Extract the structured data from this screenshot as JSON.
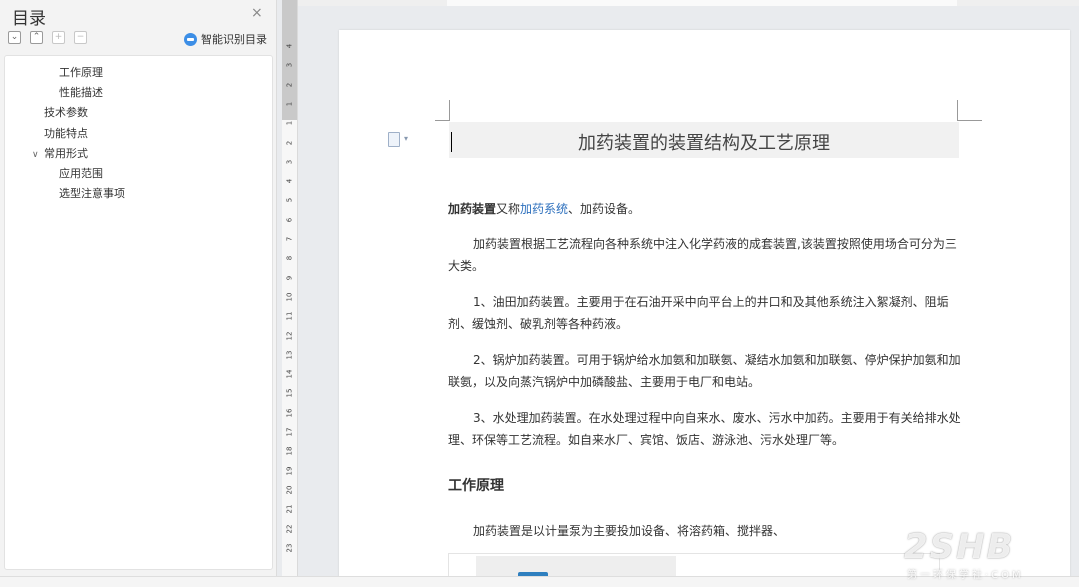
{
  "toc": {
    "title": "目录",
    "close": "×",
    "tools": [
      "⌄",
      "⌃",
      "+",
      "−"
    ],
    "smart_label": "智能识别目录",
    "items": [
      {
        "label": "工作原理",
        "level": 2,
        "arrow": ""
      },
      {
        "label": "性能描述",
        "level": 2,
        "arrow": ""
      },
      {
        "label": "技术参数",
        "level": 1,
        "arrow": ""
      },
      {
        "label": "功能特点",
        "level": 1,
        "arrow": ""
      },
      {
        "label": "常用形式",
        "level": 1,
        "arrow": "∨"
      },
      {
        "label": "应用范围",
        "level": 2,
        "arrow": ""
      },
      {
        "label": "选型注意事项",
        "level": 2,
        "arrow": ""
      }
    ]
  },
  "ruler": {
    "vertical_labels": [
      "4",
      "3",
      "2",
      "1",
      "1",
      "2",
      "3",
      "4",
      "5",
      "6",
      "7",
      "8",
      "9",
      "10",
      "11",
      "12",
      "13",
      "14",
      "15",
      "16",
      "17",
      "18",
      "19",
      "20",
      "21",
      "22",
      "23"
    ]
  },
  "document": {
    "title": "加药装置的装置结构及工艺原理",
    "intro_bold": "加药装置",
    "intro_mid": "又称",
    "intro_link": "加药系统",
    "intro_end": "、加药设备。",
    "p1": "加药装置根据工艺流程向各种系统中注入化学药液的成套装置,该装置按照使用场合可分为三大类。",
    "p2": "1、油田加药装置。主要用于在石油开采中向平台上的井口和及其他系统注入絮凝剂、阻垢剂、缓蚀剂、破乳剂等各种药液。",
    "p3": "2、锅炉加药装置。可用于锅炉给水加氨和加联氨、凝结水加氨和加联氨、停炉保护加氨和加联氨，以及向蒸汽锅炉中加磷酸盐、主要用于电厂和电站。",
    "p4": "3、水处理加药装置。在水处理过程中向自来水、废水、污水中加药。主要用于有关给排水处理、环保等工艺流程。如自来水厂、宾馆、饭店、游泳池、污水处理厂等。",
    "h2": "工作原理",
    "p5": "加药装置是以计量泵为主要投加设备、将溶药箱、搅拌器、"
  },
  "watermark": {
    "logo": "2SHB",
    "sub": "第一环保学社·COM"
  },
  "colors": {
    "link": "#2c6fbd",
    "accent": "#3c8ee6"
  }
}
